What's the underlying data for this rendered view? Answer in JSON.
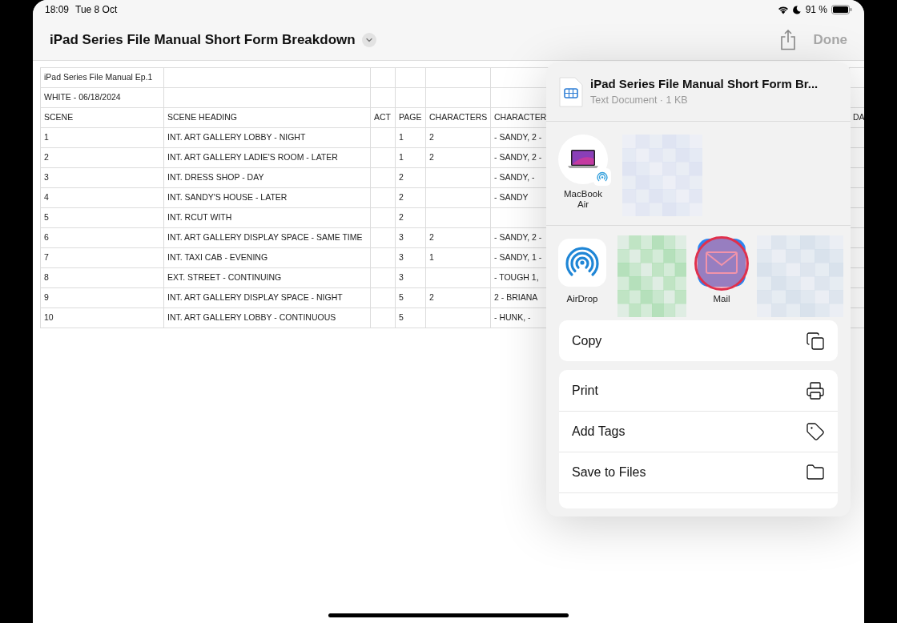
{
  "status_bar": {
    "time": "18:09",
    "date": "Tue 8 Oct",
    "battery": "91 %"
  },
  "nav_bar": {
    "title": "iPad Series File Manual Short Form Breakdown",
    "done": "Done"
  },
  "table": {
    "title_rows": [
      "iPad Series File Manual Ep.1",
      "WHITE - 06/18/2024"
    ],
    "columns": [
      "SCENE",
      "SCENE HEADING",
      "ACT",
      "PAGE",
      "CHARACTERS",
      "CHARACTER",
      "DA"
    ],
    "rows": [
      {
        "scene": "1",
        "heading": "INT. ART GALLERY LOBBY - NIGHT",
        "page": "1",
        "characters": "2",
        "character": "- SANDY, 2 -"
      },
      {
        "scene": "2",
        "heading": "INT. ART GALLERY LADIE'S ROOM - LATER",
        "page": "1",
        "characters": "2",
        "character": "- SANDY, 2 -"
      },
      {
        "scene": "3",
        "heading": "INT. DRESS SHOP - DAY",
        "page": "2",
        "character": "- SANDY,  -"
      },
      {
        "scene": "4",
        "heading": "INT. SANDY'S HOUSE - LATER",
        "page": "2",
        "character": "- SANDY"
      },
      {
        "scene": "5",
        "heading": "INT. RCUT WITH",
        "page": "2"
      },
      {
        "scene": "6",
        "heading": "INT. ART GALLERY DISPLAY SPACE - SAME TIME",
        "page": "3",
        "characters": "2",
        "character": "- SANDY, 2 -"
      },
      {
        "scene": "7",
        "heading": "INT. TAXI CAB - EVENING",
        "page": "3",
        "characters": "1",
        "character": "- SANDY, 1 -"
      },
      {
        "scene": "8",
        "heading": "EXT. STREET - CONTINUING",
        "page": "3",
        "character": "- TOUGH 1,"
      },
      {
        "scene": "9",
        "heading": "INT. ART GALLERY DISPLAY SPACE - NIGHT",
        "page": "5",
        "characters": "2",
        "character": "2 - BRIANA"
      },
      {
        "scene": "10",
        "heading": "INT. ART GALLERY LOBBY - CONTINUOUS",
        "page": "5",
        "character": "- HUNK,  -"
      }
    ]
  },
  "share_sheet": {
    "file": {
      "name": "iPad Series File Manual Short Form Br...",
      "meta": "Text Document · 1 KB"
    },
    "people": [
      {
        "kind": "device",
        "name": "MacBook Air"
      },
      {
        "kind": "picture"
      }
    ],
    "apps": [
      {
        "kind": "airdrop",
        "name": "AirDrop",
        "tapped": false
      },
      {
        "kind": "picture"
      },
      {
        "kind": "mail",
        "name": "Mail",
        "tapped": true
      },
      {
        "kind": "picture"
      }
    ],
    "action_groups": [
      [
        {
          "label": "Copy",
          "kind": "copy"
        }
      ],
      [
        {
          "label": "Print",
          "kind": "print"
        },
        {
          "label": "Add Tags",
          "kind": "tag"
        },
        {
          "label": "Save to Files",
          "kind": "folder"
        }
      ]
    ]
  }
}
